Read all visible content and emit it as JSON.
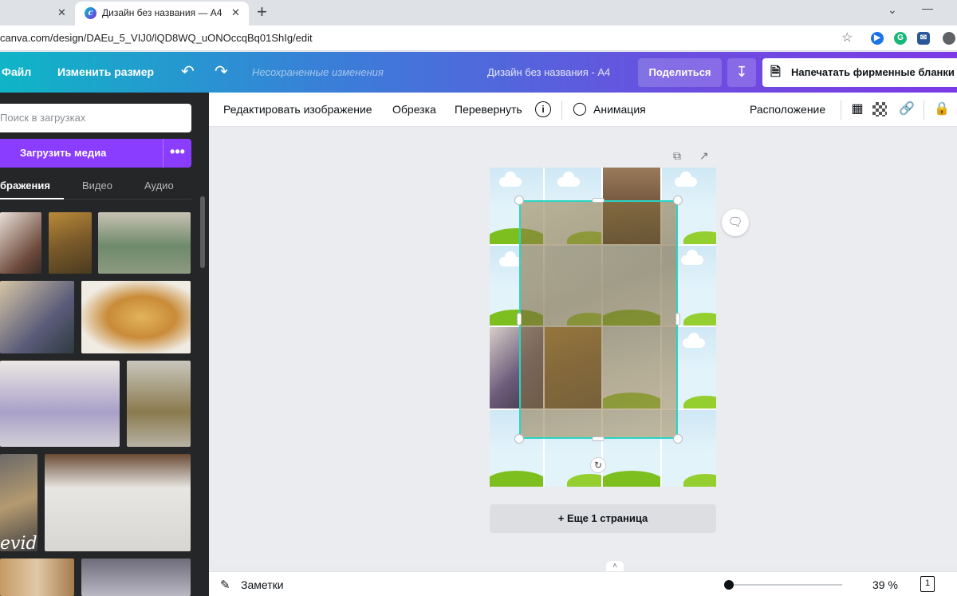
{
  "browser": {
    "prev_tab_close": "✕",
    "tab_title": "Дизайн без названия — A4",
    "tab_close": "✕",
    "new_tab": "+",
    "url": "canva.com/design/DAEu_5_VIJ0/lQD8WQ_uONOccqBq01ShIg/edit"
  },
  "header": {
    "file": "Файл",
    "resize": "Изменить размер",
    "unsaved": "Несохраненные изменения",
    "design_title": "Дизайн без названия - A4",
    "share": "Поделиться",
    "print": "Напечатать фирменные бланки"
  },
  "sidebar": {
    "search_placeholder": "Поиск в загрузках",
    "upload": "Загрузить медиа",
    "more": "•••",
    "tabs": [
      "бражения",
      "Видео",
      "Аудио"
    ],
    "watermark": "evideo"
  },
  "toolbar": {
    "edit_image": "Редактировать изображение",
    "crop": "Обрезка",
    "flip": "Перевернуть",
    "info": "i",
    "animation": "Анимация",
    "position": "Расположение"
  },
  "canvas": {
    "add_page": "+ Еще 1 страница"
  },
  "footer": {
    "notes": "Заметки",
    "zoom": "39 %",
    "page_count": "1",
    "zoom_fraction": 0.03
  },
  "colors": {
    "brand_purple": "#8b3dff",
    "selection": "#2ad4c4",
    "sidebar_bg": "#252627"
  }
}
